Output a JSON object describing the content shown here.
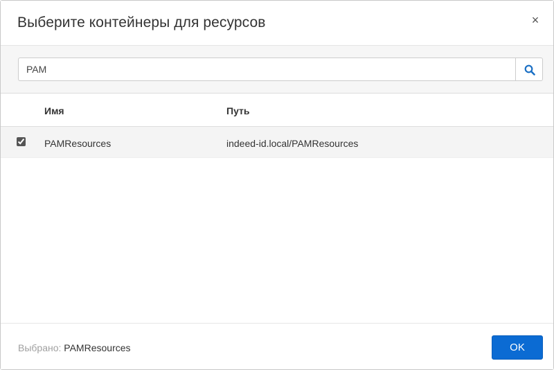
{
  "dialog": {
    "title": "Выберите контейнеры для ресурсов",
    "close_glyph": "×"
  },
  "search": {
    "value": "PAM",
    "icon": "search-icon"
  },
  "table": {
    "columns": [
      "Имя",
      "Путь"
    ],
    "rows": [
      {
        "checked": true,
        "name": "PAMResources",
        "path": "indeed-id.local/PAMResources"
      }
    ]
  },
  "footer": {
    "selected_label": "Выбрано:",
    "selected_value": "PAMResources",
    "ok_label": "OK"
  },
  "colors": {
    "primary": "#0b6bd3",
    "row_highlight": "#f4f4f4",
    "search_band": "#f6f6f6"
  }
}
